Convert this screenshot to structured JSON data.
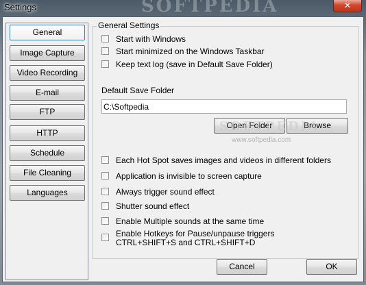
{
  "window": {
    "title": "Settings",
    "close_glyph": "✕",
    "watermark": "SOFTPEDIA",
    "watermark_mid": "SOFTPEDIA",
    "watermark_url": "www.softpedia.com"
  },
  "nav": {
    "items": [
      {
        "label": "General",
        "active": true
      },
      {
        "label": "Image Capture"
      },
      {
        "label": "Video Recording"
      },
      {
        "label": "E-mail"
      },
      {
        "label": "FTP"
      },
      {
        "label": "HTTP"
      },
      {
        "label": "Schedule"
      },
      {
        "label": "File Cleaning"
      },
      {
        "label": "Languages"
      }
    ]
  },
  "general": {
    "group_title": "General Settings",
    "options_top": [
      {
        "label": "Start with Windows",
        "checked": false
      },
      {
        "label": "Start minimized on the Windows Taskbar",
        "checked": false
      },
      {
        "label": "Keep text log (save in Default Save Folder)",
        "checked": false
      }
    ],
    "save_folder_label": "Default Save Folder",
    "save_folder_value": "C:\\Softpedia",
    "open_folder_label": "Open Folder",
    "browse_label": "Browse",
    "options_bottom": [
      {
        "label": "Each Hot Spot saves images and videos in different folders",
        "checked": false
      },
      {
        "label": "Application is invisible to screen capture",
        "checked": false
      },
      {
        "label": "Always trigger sound effect",
        "checked": false
      },
      {
        "label": "Shutter sound effect",
        "checked": false
      },
      {
        "label": "Enable Multiple sounds at the same time",
        "checked": false
      },
      {
        "label": "Enable Hotkeys for Pause/unpause triggers",
        "label_line2": "CTRL+SHIFT+S and CTRL+SHIFT+D",
        "checked": false
      }
    ]
  },
  "footer": {
    "cancel_label": "Cancel",
    "ok_label": "OK"
  }
}
